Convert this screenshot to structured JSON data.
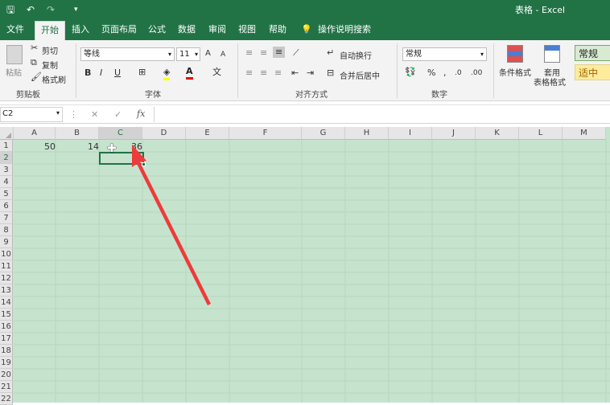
{
  "quick_access": {
    "save": "🖫",
    "undo": "↶",
    "redo": "↷",
    "more": "▾"
  },
  "window_title": "表格 - Excel",
  "tabs": [
    {
      "label": "文件"
    },
    {
      "label": "开始"
    },
    {
      "label": "插入"
    },
    {
      "label": "页面布局"
    },
    {
      "label": "公式"
    },
    {
      "label": "数据"
    },
    {
      "label": "审阅"
    },
    {
      "label": "视图"
    },
    {
      "label": "帮助"
    }
  ],
  "tell_me": "操作说明搜索",
  "clipboard": {
    "paste": "粘贴",
    "cut": "剪切",
    "copy": "复制",
    "format_painter": "格式刷",
    "label": "剪贴板"
  },
  "font": {
    "name": "等线",
    "size": "11",
    "grow": "A",
    "shrink": "A",
    "bold": "B",
    "italic": "I",
    "underline": "U",
    "label": "字体"
  },
  "alignment": {
    "wrap": "自动换行",
    "merge": "合并后居中",
    "label": "对齐方式"
  },
  "number": {
    "format": "常规",
    "percent": "%",
    "comma": ",",
    "label": "数字"
  },
  "styles": {
    "conditional": "条件格式",
    "table_format_1": "套用",
    "table_format_2": "表格格式",
    "normal": "常规",
    "neutral": "适中"
  },
  "formula_bar": {
    "name_box": "C2",
    "fx": "fx",
    "cancel": "✕",
    "enter": "✓"
  },
  "columns": [
    "A",
    "B",
    "C",
    "D",
    "E",
    "F",
    "G",
    "H",
    "I",
    "J",
    "K",
    "L",
    "M"
  ],
  "rows": [
    "1",
    "2",
    "3",
    "4",
    "5",
    "6",
    "7",
    "8",
    "9",
    "10",
    "11",
    "12",
    "13",
    "14",
    "15",
    "16",
    "17",
    "18",
    "19",
    "20",
    "21",
    "22"
  ],
  "cells": {
    "A1": "50",
    "B1": "14",
    "C1": "36"
  }
}
